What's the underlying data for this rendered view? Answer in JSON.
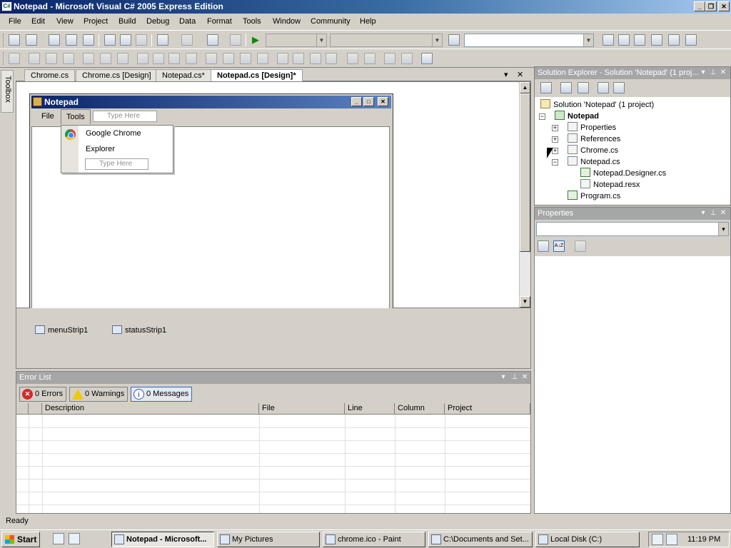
{
  "window": {
    "title": "Notepad - Microsoft Visual C# 2005 Express Edition",
    "app_icon_text": "C#",
    "minimize": "_",
    "maximize": "❐",
    "close": "✕"
  },
  "menu": {
    "items": [
      "File",
      "Edit",
      "View",
      "Project",
      "Build",
      "Debug",
      "Data",
      "Format",
      "Tools",
      "Window",
      "Community",
      "Help"
    ]
  },
  "doc_tabs": [
    {
      "label": "Chrome.cs",
      "active": false
    },
    {
      "label": "Chrome.cs [Design]",
      "active": false
    },
    {
      "label": "Notepad.cs*",
      "active": false
    },
    {
      "label": "Notepad.cs [Design]*",
      "active": true
    }
  ],
  "doc_tab_buttons": {
    "dropdown": "▾",
    "close": "✕"
  },
  "toolbox": {
    "label": "Toolbox"
  },
  "designer": {
    "form_title": "Notepad",
    "form_controls": {
      "minimize": "_",
      "maximize": "□",
      "close": "✕"
    },
    "form_menu": {
      "file": "File",
      "tools": "Tools",
      "type_here": "Type Here"
    },
    "dropdown_items": [
      "Google Chrome",
      "Explorer"
    ],
    "dropdown_type_here": "Type Here",
    "tray_items": [
      "menuStrip1",
      "statusStrip1"
    ],
    "scroll_up": "▲",
    "scroll_down": "▼"
  },
  "error_list": {
    "title": "Error List",
    "errors_label": "0 Errors",
    "warnings_label": "0 Warnings",
    "messages_label": "0 Messages",
    "error_icon": "✕",
    "warning_icon": "!",
    "info_icon": "i",
    "columns": [
      "Description",
      "File",
      "Line",
      "Column",
      "Project"
    ]
  },
  "panel_buttons": {
    "dropdown": "▾",
    "pin": "⊥",
    "close": "✕"
  },
  "solution_explorer": {
    "title": "Solution Explorer - Solution 'Notepad' (1 proj...",
    "tree": {
      "solution": "Solution 'Notepad' (1 project)",
      "project": "Notepad",
      "properties": "Properties",
      "references": "References",
      "chrome": "Chrome.cs",
      "notepad": "Notepad.cs",
      "notepad_designer": "Notepad.Designer.cs",
      "notepad_resx": "Notepad.resx",
      "program": "Program.cs"
    },
    "expand": "+",
    "collapse": "−"
  },
  "properties_panel": {
    "title": "Properties",
    "combo_arrow": "▾",
    "sort_az": "A↓Z"
  },
  "status": {
    "text": "Ready"
  },
  "taskbar": {
    "start": "Start",
    "tasks": [
      {
        "label": "Notepad - Microsoft...",
        "active": true
      },
      {
        "label": "My Pictures",
        "active": false
      },
      {
        "label": "chrome.ico - Paint",
        "active": false
      },
      {
        "label": "C:\\Documents and Set...",
        "active": false
      },
      {
        "label": "Local Disk (C:)",
        "active": false
      }
    ],
    "clock": "11:19 PM"
  },
  "colors": {
    "titlebar_start": "#0a246a",
    "titlebar_end": "#a6caf0",
    "face": "#d4d0c8",
    "panel_header": "#a6a6a6"
  }
}
